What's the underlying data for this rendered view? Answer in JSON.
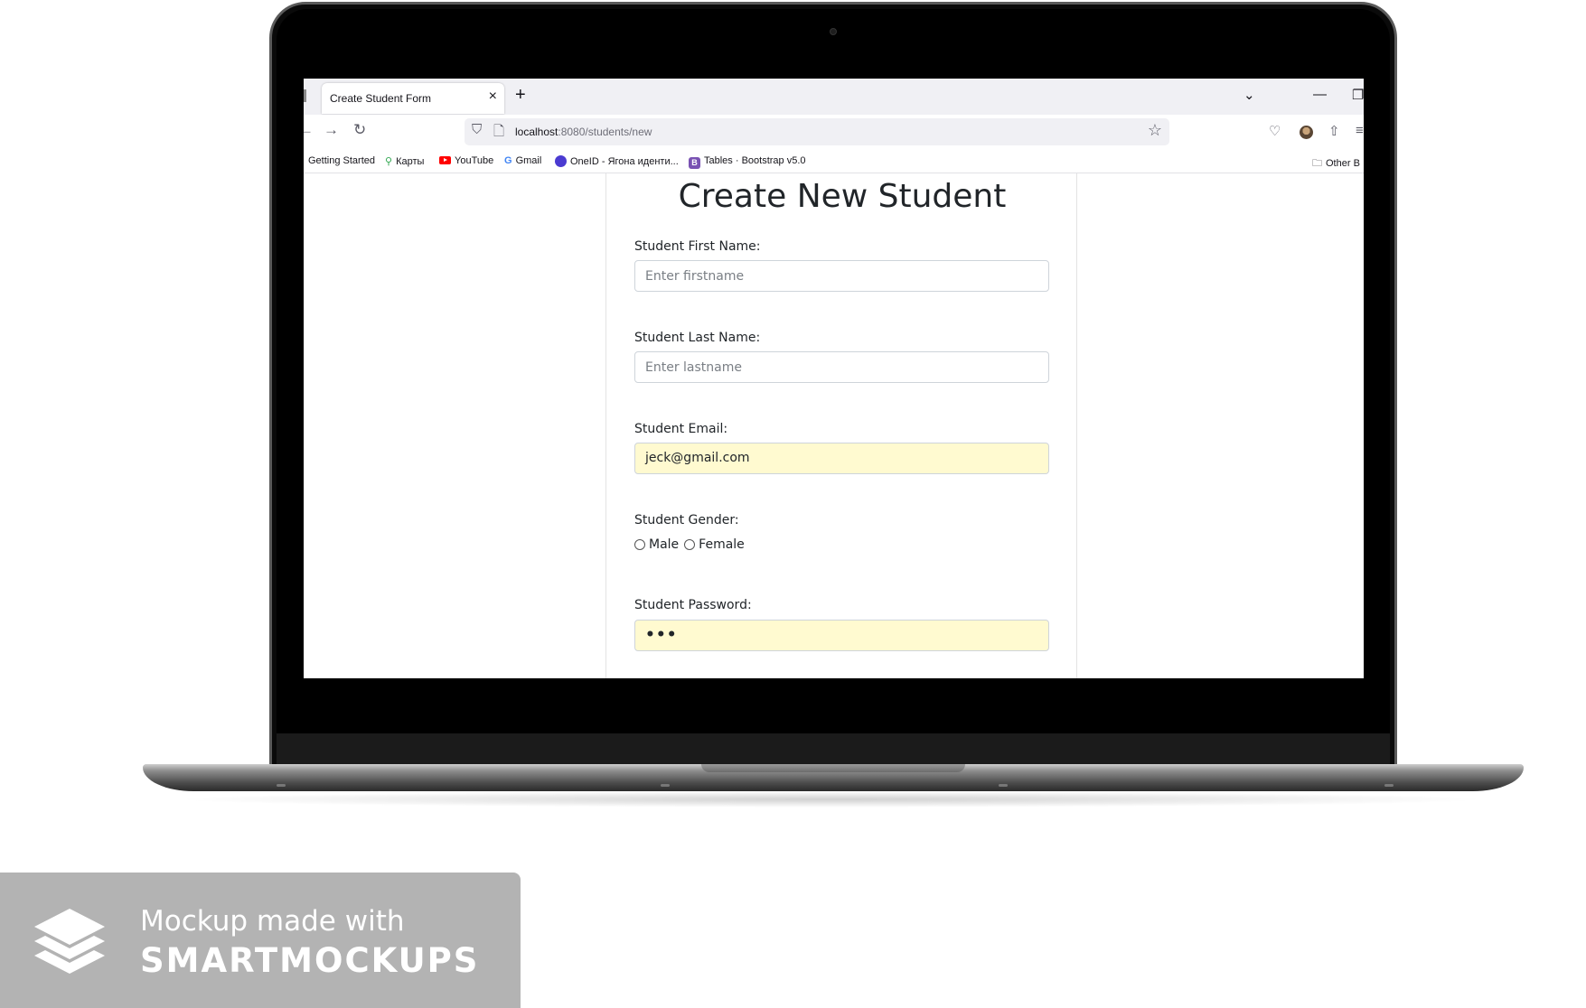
{
  "browser": {
    "tab_title": "Create Student Form",
    "tab_close": "×",
    "new_tab": "+",
    "url_host": "localhost",
    "url_rest": ":8080/students/new",
    "bookmarks": [
      {
        "label": "Getting Started",
        "icon": "firefox-icon"
      },
      {
        "label": "Карты",
        "icon": "maps-pin-icon"
      },
      {
        "label": "YouTube",
        "icon": "youtube-icon"
      },
      {
        "label": "Gmail",
        "icon": "google-icon"
      },
      {
        "label": "OneID - Ягона иденти...",
        "icon": "oneid-icon"
      },
      {
        "label": "Tables · Bootstrap v5.0",
        "icon": "bootstrap-icon"
      }
    ],
    "other_bookmarks": "Other B"
  },
  "form": {
    "title": "Create New Student",
    "first_name_label": "Student First Name:",
    "first_name_placeholder": "Enter firstname",
    "last_name_label": "Student Last Name:",
    "last_name_placeholder": "Enter lastname",
    "email_label": "Student Email:",
    "email_value": "jeck@gmail.com",
    "gender_label": "Student Gender:",
    "gender_options": [
      "Male",
      "Female"
    ],
    "password_label": "Student Password:",
    "password_value": "•••"
  },
  "watermark": {
    "line1": "Mockup made with",
    "line2": "SMARTMOCKUPS"
  },
  "colors": {
    "autofill": "#fffad0",
    "screen_bezel": "#000000"
  }
}
